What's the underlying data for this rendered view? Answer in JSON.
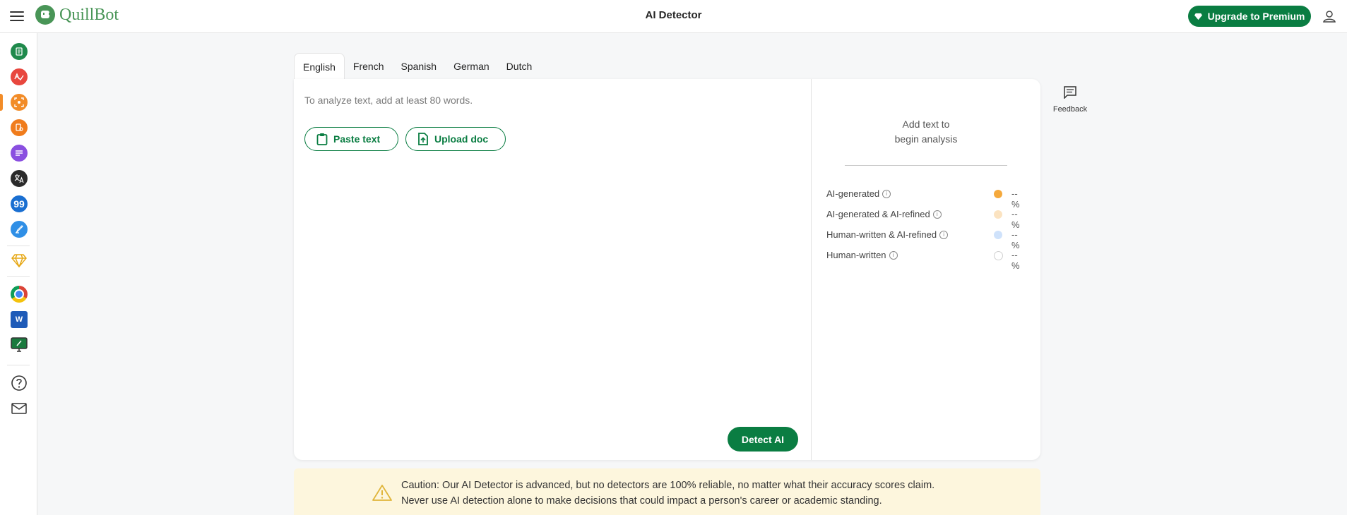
{
  "header": {
    "app_name": "QuillBot",
    "page_title": "AI Detector",
    "upgrade_label": "Upgrade to Premium"
  },
  "sidebar": {
    "items": [
      {
        "name": "paraphraser",
        "color": "#1f8a4c",
        "icon": "document-icon"
      },
      {
        "name": "grammar-checker",
        "color": "#e8473e",
        "icon": "check-icon"
      },
      {
        "name": "ai-detector",
        "color": "#f28c28",
        "icon": "scan-icon",
        "active": true
      },
      {
        "name": "plagiarism-checker",
        "color": "#f07c1c",
        "icon": "copy-icon"
      },
      {
        "name": "summarizer",
        "color": "#8a4fe0",
        "icon": "lines-icon"
      },
      {
        "name": "translator",
        "color": "#2b2b2b",
        "icon": "translate-icon"
      },
      {
        "name": "citation-generator",
        "color": "#1a6fd1",
        "icon": "quote-icon"
      },
      {
        "name": "ai-writer",
        "color": "#2f8fe6",
        "icon": "pen-icon"
      },
      {
        "name": "premium",
        "color": "#e6a817",
        "icon": "diamond-icon"
      },
      {
        "name": "chrome-extension",
        "color": "#ffffff",
        "icon": "chrome-icon"
      },
      {
        "name": "word-addin",
        "color": "#1e5bb8",
        "icon": "word-icon"
      },
      {
        "name": "desktop-app",
        "color": "#1a7a3e",
        "icon": "monitor-icon"
      },
      {
        "name": "help",
        "color": "#333333",
        "icon": "help-icon"
      },
      {
        "name": "contact",
        "color": "#333333",
        "icon": "mail-icon"
      }
    ]
  },
  "tabs": [
    {
      "label": "English",
      "active": true
    },
    {
      "label": "French",
      "active": false
    },
    {
      "label": "Spanish",
      "active": false
    },
    {
      "label": "German",
      "active": false
    },
    {
      "label": "Dutch",
      "active": false
    }
  ],
  "editor": {
    "placeholder": "To analyze text, add at least 80 words.",
    "paste_label": "Paste text",
    "upload_label": "Upload doc",
    "detect_label": "Detect AI"
  },
  "results": {
    "empty_line1": "Add text to",
    "empty_line2": "begin analysis",
    "legend": [
      {
        "label": "AI-generated",
        "value": "--%",
        "color": "#f5a93c"
      },
      {
        "label": "AI-generated & AI-refined",
        "value": "--%",
        "color": "#fbe3c1"
      },
      {
        "label": "Human-written & AI-refined",
        "value": "--%",
        "color": "#cfe2fb"
      },
      {
        "label": "Human-written",
        "value": "--%",
        "color": "#ffffff"
      }
    ]
  },
  "feedback_label": "Feedback",
  "caution": {
    "line1": "Caution: Our AI Detector is advanced, but no detectors are 100% reliable, no matter what their accuracy scores claim.",
    "line2": "Never use AI detection alone to make decisions that could impact a person's career or academic standing."
  },
  "colors": {
    "brand_green": "#0a7d42",
    "logo_green": "#499557",
    "caution_bg": "#fdf6dd"
  }
}
